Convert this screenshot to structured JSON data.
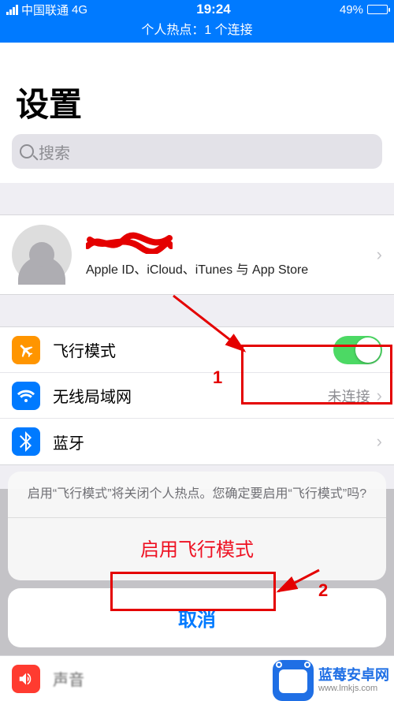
{
  "statusbar": {
    "carrier": "中国联通",
    "network": "4G",
    "time": "19:24",
    "battery_pct": "49%"
  },
  "hotspot_banner": "个人热点：1 个连接",
  "title": "设置",
  "search_placeholder": "搜索",
  "profile": {
    "subtitle": "Apple ID、iCloud、iTunes 与 App Store"
  },
  "rows": {
    "airplane": "飞行模式",
    "wifi": "无线局域网",
    "wifi_status": "未连接",
    "bluetooth": "蓝牙",
    "sound": "声音"
  },
  "annotations": {
    "num1": "1",
    "num2": "2"
  },
  "action_sheet": {
    "message": "启用“飞行模式”将关闭个人热点。您确定要启用“飞行模式”吗?",
    "enable": "启用飞行模式",
    "cancel": "取消"
  },
  "watermark": {
    "name": "蓝莓安卓网",
    "url": "www.lmkjs.com"
  }
}
